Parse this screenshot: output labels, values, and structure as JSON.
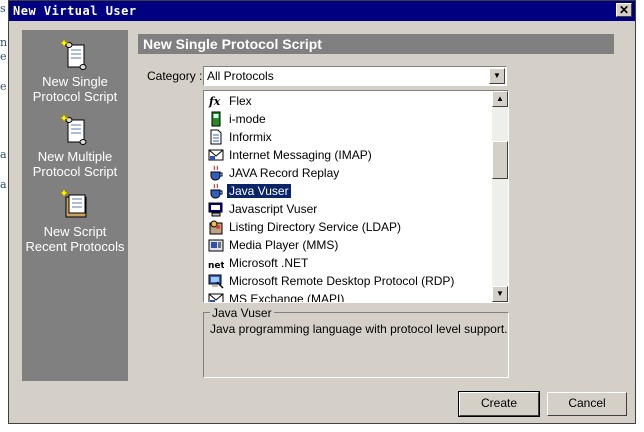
{
  "background": {
    "fragments": [
      "s",
      "n",
      "e",
      "e",
      "a",
      "a"
    ]
  },
  "window": {
    "title": "New Virtual User",
    "close_glyph": "✕"
  },
  "left_panel": {
    "items": [
      {
        "label": "New Single Protocol Script",
        "icon": "scroll-icon"
      },
      {
        "label": "New Multiple Protocol Script",
        "icon": "scroll-icon"
      },
      {
        "label": "New Script Recent Protocols",
        "icon": "scroll-book-icon"
      }
    ]
  },
  "main": {
    "header": "New Single Protocol Script",
    "category_label": "Category :",
    "category_value": "All Protocols",
    "protocols": [
      {
        "label": "Flex",
        "icon": "flex-fx-icon",
        "selected": false
      },
      {
        "label": "i-mode",
        "icon": "imode-phone-icon",
        "selected": false
      },
      {
        "label": "Informix",
        "icon": "document-icon",
        "selected": false
      },
      {
        "label": "Internet Messaging (IMAP)",
        "icon": "mail-icon",
        "selected": false
      },
      {
        "label": "JAVA Record Replay",
        "icon": "java-cup-icon",
        "selected": false
      },
      {
        "label": "Java Vuser",
        "icon": "java-cup-icon",
        "selected": true
      },
      {
        "label": "Javascript Vuser",
        "icon": "computer-icon",
        "selected": false
      },
      {
        "label": "Listing Directory Service (LDAP)",
        "icon": "directory-icon",
        "selected": false
      },
      {
        "label": "Media Player (MMS)",
        "icon": "media-player-icon",
        "selected": false
      },
      {
        "label": "Microsoft .NET",
        "icon": "dotnet-icon",
        "selected": false
      },
      {
        "label": "Microsoft Remote Desktop Protocol (RDP)",
        "icon": "remote-desktop-icon",
        "selected": false
      },
      {
        "label": "MS Exchange (MAPI)",
        "icon": "mail-icon",
        "selected": false
      }
    ],
    "description_title": "Java Vuser",
    "description_text": "Java programming language with protocol level support."
  },
  "buttons": {
    "create": "Create",
    "cancel": "Cancel"
  },
  "colors": {
    "titlebar": "#000080",
    "selection": "#0a246a",
    "panel": "#808080",
    "face": "#d4d0c8"
  }
}
